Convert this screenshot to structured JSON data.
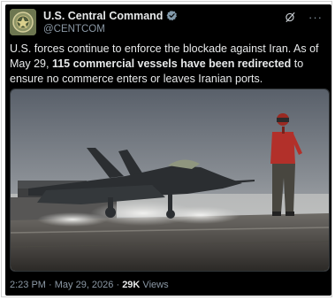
{
  "account": {
    "display_name": "U.S. Central Command",
    "handle": "@CENTCOM",
    "avatar_icon": "centcom-seal-icon",
    "verified_icon": "verified-badge-icon",
    "verified_color": "#829aab"
  },
  "header_actions": {
    "grok_icon": "grok-icon",
    "more_label": "···"
  },
  "tweet": {
    "text_part1": "U.S. forces continue to enforce the blockade against Iran. As of May 29, ",
    "text_bold": "115 commercial vessels have been redirected",
    "text_part2": " to ensure no commerce enters or leaves Iranian ports."
  },
  "media": {
    "type": "photo",
    "subject": "fighter-jet-on-carrier-deck-with-crew-member"
  },
  "meta": {
    "time": "2:23 PM",
    "separator1": " · ",
    "date": "May 29, 2026",
    "separator2": " · ",
    "views_count": "29K",
    "views_label": " Views"
  },
  "colors": {
    "background": "#000000",
    "text": "#e7e9ea",
    "secondary_text": "#8b98a5"
  }
}
